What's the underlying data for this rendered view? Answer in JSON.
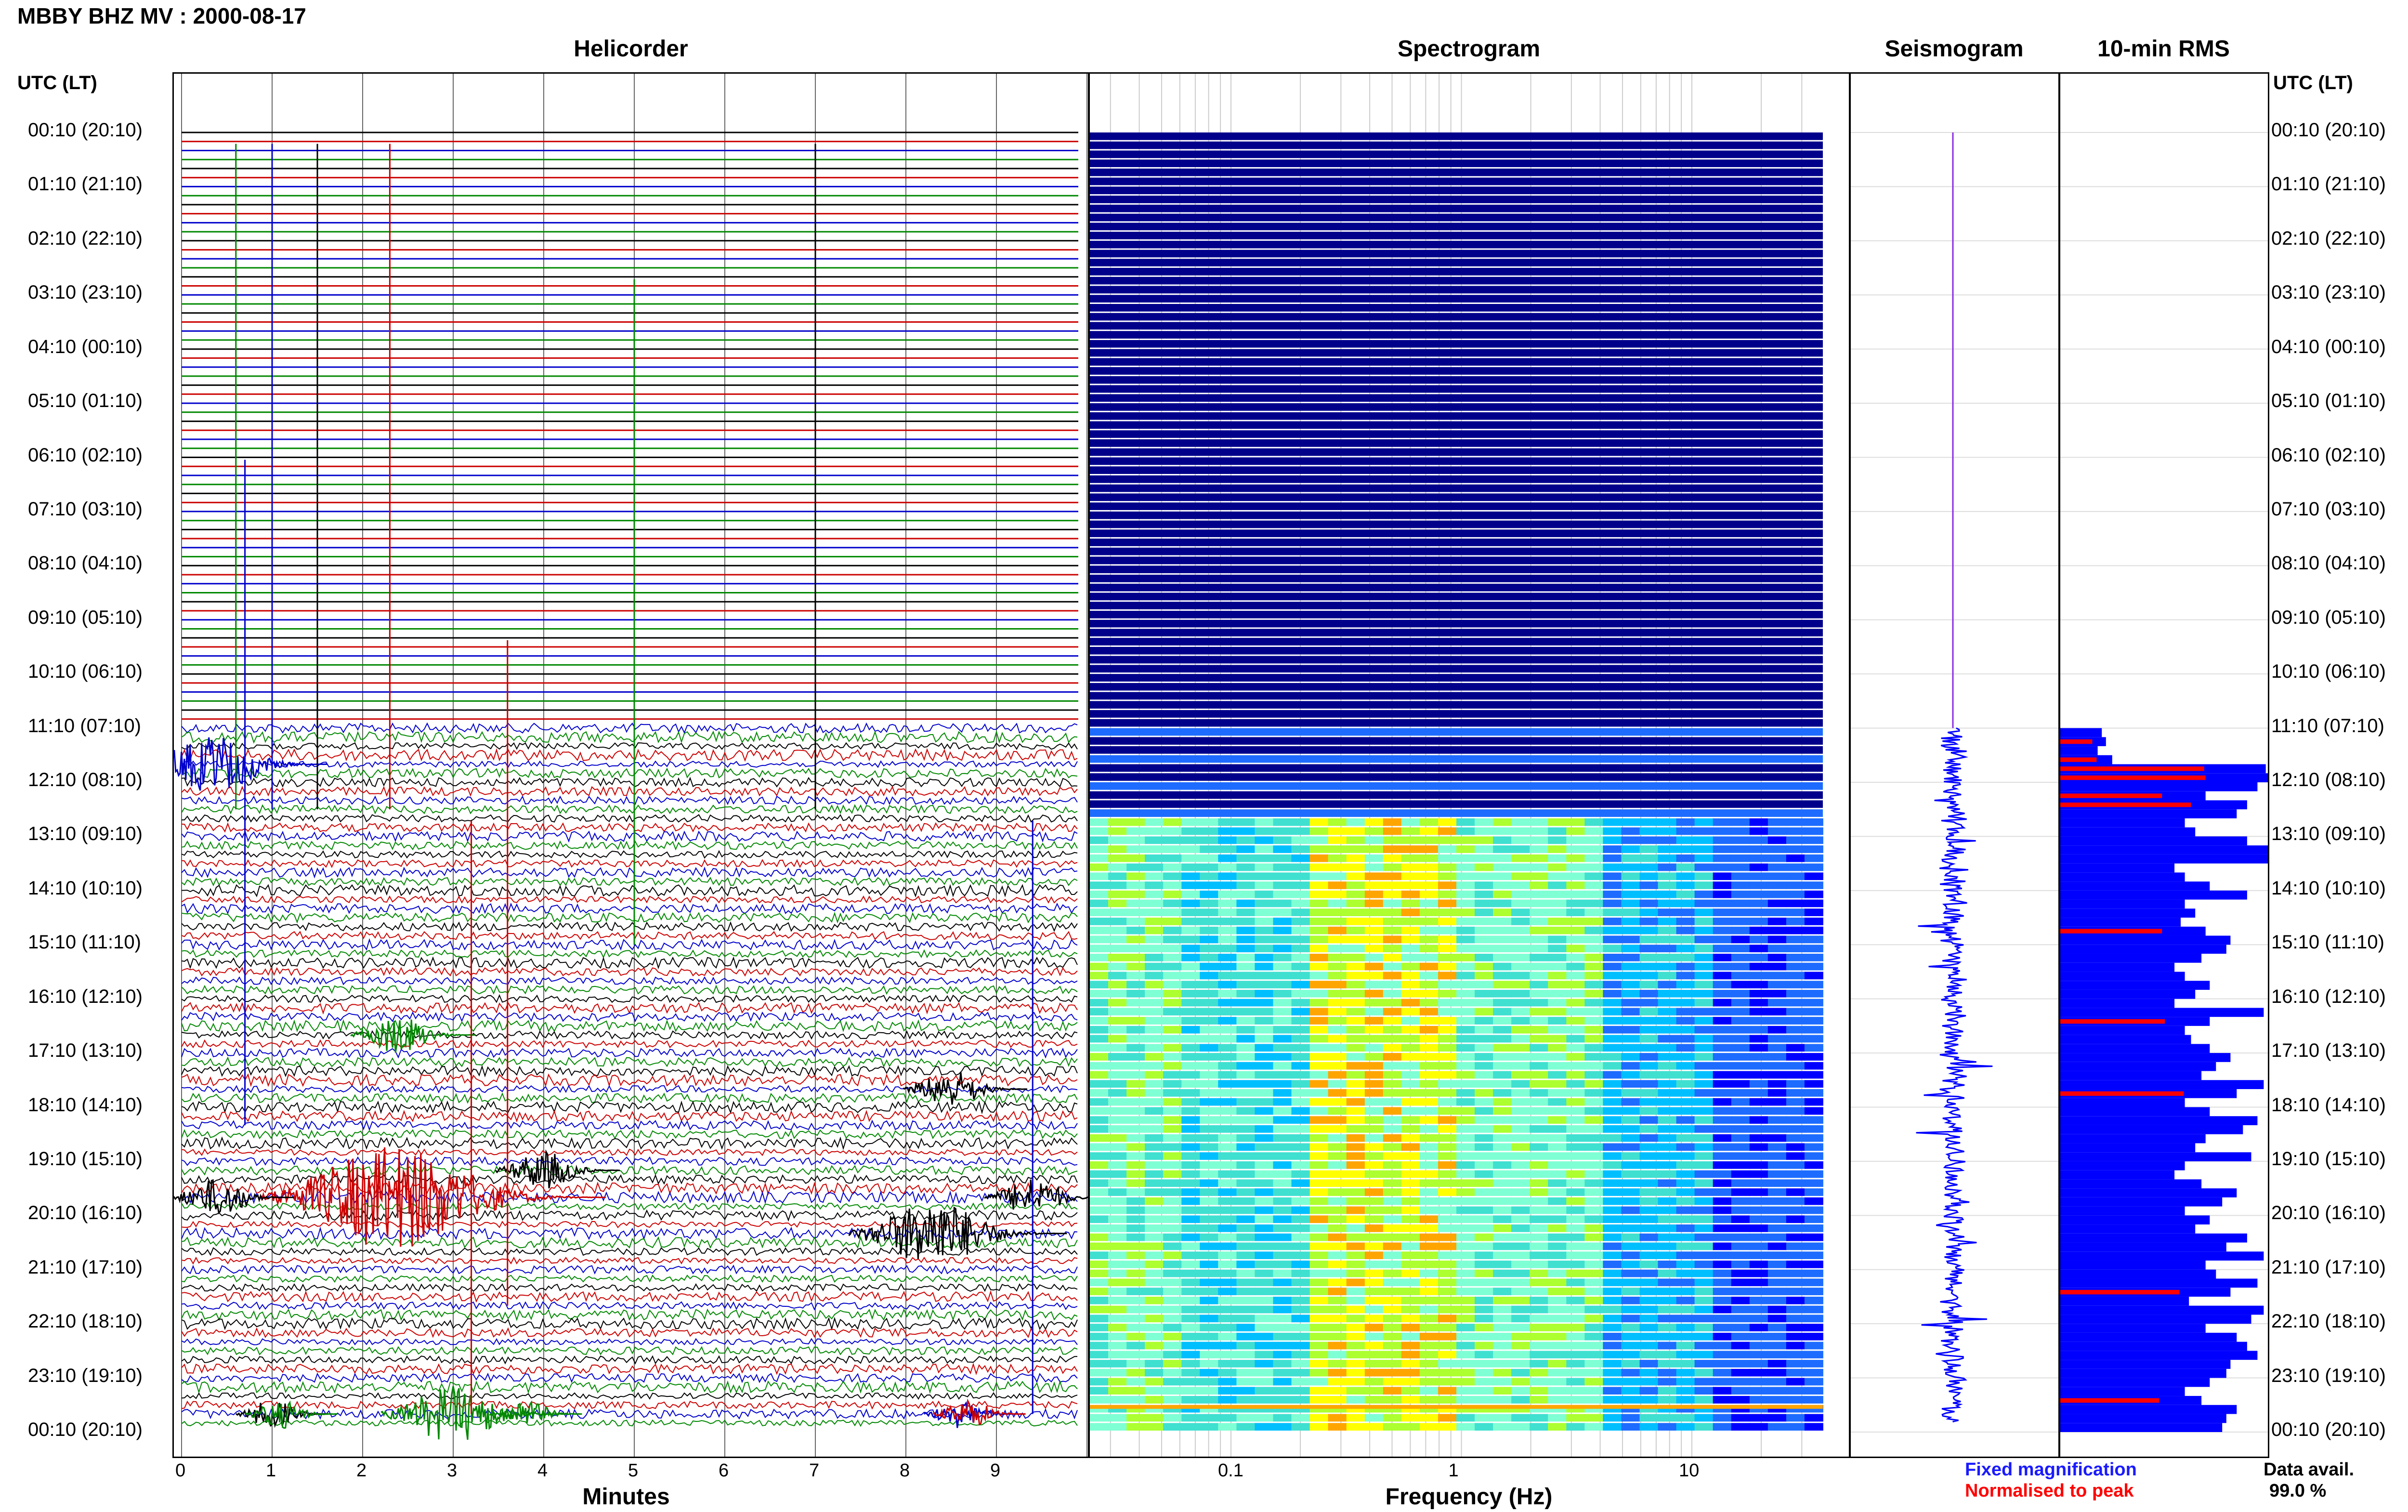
{
  "title": "MBBY BHZ MV : 2000-08-17",
  "panels": {
    "helicorder": "Helicorder",
    "spectrogram": "Spectrogram",
    "seismogram": "Seismogram",
    "rms": "10-min RMS"
  },
  "left_axis_title": "UTC (LT)",
  "right_axis_title": "UTC (LT)",
  "time_labels": [
    "00:10 (20:10)",
    "01:10 (21:10)",
    "02:10 (22:10)",
    "03:10 (23:10)",
    "04:10 (00:10)",
    "05:10 (01:10)",
    "06:10 (02:10)",
    "07:10 (03:10)",
    "08:10 (04:10)",
    "09:10 (05:10)",
    "10:10 (06:10)",
    "11:10 (07:10)",
    "12:10 (08:10)",
    "13:10 (09:10)",
    "14:10 (10:10)",
    "15:10 (11:10)",
    "16:10 (12:10)",
    "17:10 (13:10)",
    "18:10 (14:10)",
    "19:10 (15:10)",
    "20:10 (16:10)",
    "21:10 (17:10)",
    "22:10 (18:10)",
    "23:10 (19:10)",
    "00:10 (20:10)"
  ],
  "helicorder_x": {
    "label": "Minutes",
    "ticks": [
      "0",
      "1",
      "2",
      "3",
      "4",
      "5",
      "6",
      "7",
      "8",
      "9"
    ]
  },
  "spectrogram_x": {
    "label": "Frequency (Hz)",
    "ticks": [
      "0.1",
      "1",
      "10"
    ]
  },
  "legend": {
    "fixed": "Fixed magnification",
    "normalised": "Normalised to peak"
  },
  "data_avail": {
    "label": "Data avail.",
    "value": "99.0 %"
  },
  "colors": {
    "trace_cycle": [
      "#000000",
      "#cc0000",
      "#0000cc",
      "#008800"
    ],
    "spectro_background": "#00008b",
    "rms_fixed": "#0000ff",
    "rms_normalised": "#ff0000"
  },
  "chart_data": {
    "type": "bar",
    "title": "10-min RMS",
    "note_levels": "relative RMS per 10-minute row, 0..1",
    "rows_start": "00:10",
    "row_minutes": 10,
    "rms_rows_start_index": 66,
    "rms_values": [
      0.2,
      0.22,
      0.18,
      0.25,
      0.99,
      1.0,
      0.95,
      0.7,
      0.9,
      0.85,
      0.6,
      0.65,
      0.9,
      1.0,
      1.0,
      0.55,
      0.6,
      0.72,
      0.9,
      0.6,
      0.65,
      0.58,
      0.7,
      0.82,
      0.8,
      0.68,
      0.55,
      0.6,
      0.72,
      0.65,
      0.55,
      0.98,
      0.72,
      0.6,
      0.63,
      0.72,
      0.82,
      0.75,
      0.68,
      0.98,
      0.85,
      0.6,
      0.72,
      0.95,
      0.88,
      0.7,
      0.65,
      0.92,
      0.6,
      0.55,
      0.68,
      0.85,
      0.78,
      0.6,
      0.72,
      0.65,
      0.9,
      0.8,
      0.98,
      0.7,
      0.75,
      0.95,
      0.82,
      0.62,
      0.98,
      0.92,
      0.7,
      0.85,
      0.9,
      0.95,
      0.82,
      0.8,
      0.72,
      0.6,
      0.68,
      0.85,
      0.8,
      0.78
    ],
    "rms_normalised_rows": [
      67,
      69,
      70,
      71,
      73,
      74,
      88,
      98,
      106,
      128,
      140,
      145,
      150,
      160,
      166,
      168,
      170,
      172
    ]
  }
}
